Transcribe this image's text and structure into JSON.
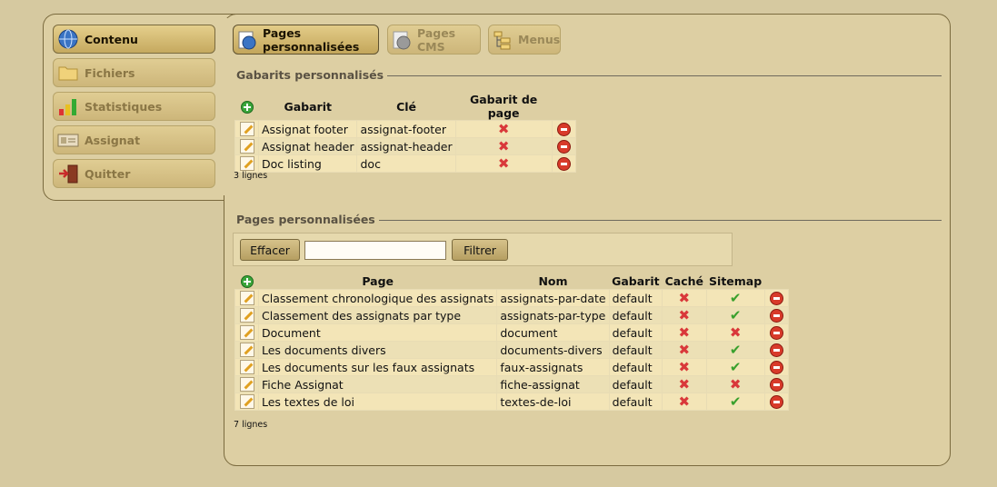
{
  "sidebar": {
    "items": [
      {
        "label": "Contenu",
        "icon": "globe-icon",
        "active": true
      },
      {
        "label": "Fichiers",
        "icon": "folder-icon",
        "active": false
      },
      {
        "label": "Statistiques",
        "icon": "bar-chart-icon",
        "active": false
      },
      {
        "label": "Assignat",
        "icon": "banknote-icon",
        "active": false
      },
      {
        "label": "Quitter",
        "icon": "exit-door-icon",
        "active": false
      }
    ]
  },
  "tabs": [
    {
      "label": "Pages personnalisées",
      "icon": "globe-page-icon",
      "active": true
    },
    {
      "label": "Pages CMS",
      "icon": "cms-page-icon",
      "active": false
    },
    {
      "label": "Menus",
      "icon": "menu-tree-icon",
      "active": false
    }
  ],
  "gabarits": {
    "legend": "Gabarits personnalisés",
    "columns": [
      "Gabarit",
      "Clé",
      "Gabarit de page"
    ],
    "rows": [
      {
        "gabarit": "Assignat footer",
        "cle": "assignat-footer",
        "page": false
      },
      {
        "gabarit": "Assignat header",
        "cle": "assignat-header",
        "page": false
      },
      {
        "gabarit": "Doc listing",
        "cle": "doc",
        "page": false
      }
    ],
    "count": "3 lignes"
  },
  "pages": {
    "legend": "Pages personnalisées",
    "filter": {
      "clear_label": "Effacer",
      "filter_label": "Filtrer",
      "value": ""
    },
    "columns": [
      "Page",
      "Nom",
      "Gabarit",
      "Caché",
      "Sitemap"
    ],
    "rows": [
      {
        "page": "Classement chronologique des assignats",
        "nom": "assignats-par-date",
        "gabarit": "default",
        "cache": false,
        "sitemap": true
      },
      {
        "page": "Classement des assignats par type",
        "nom": "assignats-par-type",
        "gabarit": "default",
        "cache": false,
        "sitemap": true
      },
      {
        "page": "Document",
        "nom": "document",
        "gabarit": "default",
        "cache": false,
        "sitemap": false
      },
      {
        "page": "Les documents divers",
        "nom": "documents-divers",
        "gabarit": "default",
        "cache": false,
        "sitemap": true
      },
      {
        "page": "Les documents sur les faux assignats",
        "nom": "faux-assignats",
        "gabarit": "default",
        "cache": false,
        "sitemap": true
      },
      {
        "page": "Fiche Assignat",
        "nom": "fiche-assignat",
        "gabarit": "default",
        "cache": false,
        "sitemap": false
      },
      {
        "page": "Les textes de loi",
        "nom": "textes-de-loi",
        "gabarit": "default",
        "cache": false,
        "sitemap": true
      }
    ],
    "count": "7 lignes"
  }
}
